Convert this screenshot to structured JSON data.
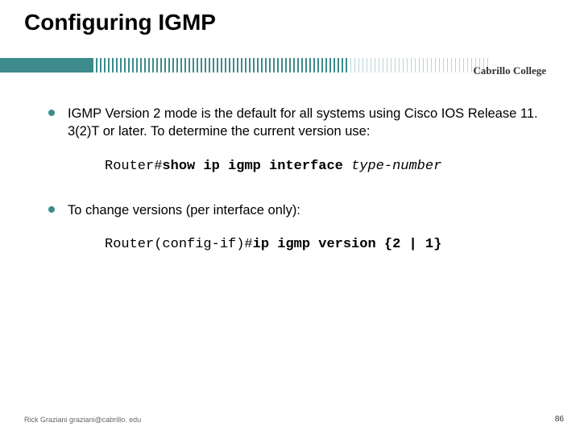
{
  "title": "Configuring IGMP",
  "brand": "Cabrillo College",
  "bullets": {
    "b1": "IGMP Version 2 mode is the default for all systems using Cisco IOS Release 11. 3(2)T or later. To determine the current version use:",
    "b2": "To change versions (per interface only):"
  },
  "commands": {
    "c1": {
      "prompt": "Router#",
      "bold": "show ip igmp interface ",
      "ital": "type-number"
    },
    "c2": {
      "prompt": "Router(config-if)#",
      "bold": "ip igmp version {2 | 1}"
    }
  },
  "footer": {
    "left": "Rick Graziani  graziani@cabrillo. edu",
    "right": "86"
  }
}
